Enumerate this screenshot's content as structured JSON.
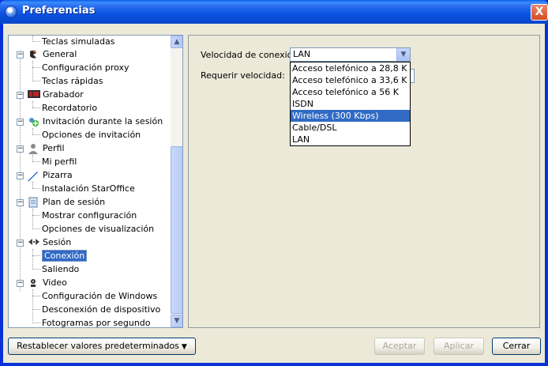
{
  "window": {
    "title": "Preferencias",
    "close_glyph": "X",
    "accent_color": "#0a52e0"
  },
  "tree": {
    "items": [
      {
        "label": "Teclas simuladas",
        "level": 2
      },
      {
        "label": "General",
        "level": 1,
        "icon": "general-icon"
      },
      {
        "label": "Configuración proxy",
        "level": 2
      },
      {
        "label": "Teclas rápidas",
        "level": 2
      },
      {
        "label": "Grabador",
        "level": 1,
        "icon": "recorder-icon"
      },
      {
        "label": "Recordatorio",
        "level": 2
      },
      {
        "label": "Invitación durante la sesión",
        "level": 1,
        "icon": "invitation-icon"
      },
      {
        "label": "Opciones de invitación",
        "level": 2
      },
      {
        "label": "Perfil",
        "level": 1,
        "icon": "profile-icon"
      },
      {
        "label": "Mi perfil",
        "level": 2
      },
      {
        "label": "Pizarra",
        "level": 1,
        "icon": "whiteboard-icon"
      },
      {
        "label": "Instalación StarOffice",
        "level": 2
      },
      {
        "label": "Plan de sesión",
        "level": 1,
        "icon": "session-plan-icon"
      },
      {
        "label": "Mostrar configuración",
        "level": 2
      },
      {
        "label": "Opciones de visualización",
        "level": 2
      },
      {
        "label": "Sesión",
        "level": 1,
        "icon": "session-icon"
      },
      {
        "label": "Conexión",
        "level": 2,
        "selected": true
      },
      {
        "label": "Saliendo",
        "level": 2
      },
      {
        "label": "Video",
        "level": 1,
        "icon": "video-icon"
      },
      {
        "label": "Configuración de Windows",
        "level": 2
      },
      {
        "label": "Desconexión de dispositivo",
        "level": 2
      },
      {
        "label": "Fotogramas por segundo",
        "level": 2
      }
    ]
  },
  "panel": {
    "speed_label": "Velocidad de conexión:",
    "speed_value": "LAN",
    "require_label": "Requerir velocidad:",
    "options": [
      "Acceso telefónico a 28,8 K",
      "Acceso telefónico a 33,6 K",
      "Acceso telefónico a 56 K",
      "ISDN",
      "Wireless (300 Kbps)",
      "Cable/DSL",
      "LAN"
    ],
    "highlighted_option": "Wireless (300 Kbps)"
  },
  "footer": {
    "restore_label": "Restablecer valores predeterminados",
    "accept_label": "Aceptar",
    "apply_label": "Aplicar",
    "close_label": "Cerrar"
  }
}
